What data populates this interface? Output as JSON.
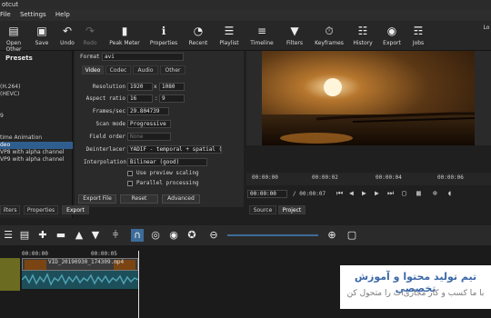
{
  "title": "Shotcut",
  "menu": [
    "otcut",
    "File",
    "Settings",
    "Help"
  ],
  "window_title_partial": "otcut",
  "toolbar": [
    {
      "label": "Open Other",
      "icon": "folder-icon",
      "enabled": true
    },
    {
      "label": "Save",
      "icon": "save-icon",
      "enabled": true
    },
    {
      "label": "Undo",
      "icon": "undo-icon",
      "enabled": true
    },
    {
      "label": "Redo",
      "icon": "redo-icon",
      "enabled": false
    },
    {
      "label": "Peak Meter",
      "icon": "peak-meter-icon",
      "enabled": true
    },
    {
      "label": "Properties",
      "icon": "info-icon",
      "enabled": true
    },
    {
      "label": "Recent",
      "icon": "recent-icon",
      "enabled": true
    },
    {
      "label": "Playlist",
      "icon": "playlist-icon",
      "enabled": true
    },
    {
      "label": "Timeline",
      "icon": "timeline-icon",
      "enabled": true
    },
    {
      "label": "Filters",
      "icon": "filter-icon",
      "enabled": true
    },
    {
      "label": "Keyframes",
      "icon": "keyframes-icon",
      "enabled": true
    },
    {
      "label": "History",
      "icon": "history-icon",
      "enabled": true
    },
    {
      "label": "Export",
      "icon": "export-icon",
      "enabled": true
    },
    {
      "label": "Jobs",
      "icon": "jobs-icon",
      "enabled": true
    },
    {
      "label": "Lo",
      "icon": "",
      "enabled": true
    }
  ],
  "presets": {
    "title": "Presets",
    "items": [
      {
        "label": "(H.264)",
        "selected": false
      },
      {
        "label": "(HEVC)",
        "selected": false
      },
      {
        "label": "9",
        "selected": false
      },
      {
        "label": "time Animation",
        "selected": false
      },
      {
        "label": "deo",
        "selected": true
      },
      {
        "label": "VP8 with alpha channel",
        "selected": false
      },
      {
        "label": "VP9 with alpha channel",
        "selected": false
      }
    ]
  },
  "export": {
    "format_label": "Format",
    "format_value": "avi",
    "tabs": [
      "Video",
      "Codec",
      "Audio",
      "Other"
    ],
    "fields": {
      "resolution_label": "Resolution",
      "res_w": "1920",
      "res_x": "x",
      "res_h": "1080",
      "aspect_label": "Aspect ratio",
      "asp_w": "16",
      "asp_colon": ":",
      "asp_h": "9",
      "fps_label": "Frames/sec",
      "fps": "29.804739",
      "scan_label": "Scan mode",
      "scan": "Progressive",
      "field_label": "Field order",
      "field": "None",
      "deint_label": "Deinterlacer",
      "deint": "YADIF - temporal + spatial (",
      "interp_label": "Interpolation",
      "interp": "Bilinear (good)",
      "preview_label": "Use preview scaling",
      "parallel_label": "Parallel processing"
    },
    "buttons": {
      "export": "Export File",
      "reset": "Reset",
      "advanced": "Advanced"
    }
  },
  "bottom_tabs": [
    "ilters",
    "Properties",
    "Export"
  ],
  "viewer": {
    "ruler": [
      "00:00:00",
      "00:00:02",
      "00:00:04",
      "00:00:06"
    ],
    "current": "00:00:00",
    "duration": "/  00:00:07",
    "tabs": [
      "Source",
      "Project"
    ]
  },
  "timeline": {
    "ruler": [
      "00:00:00",
      "00:00:05"
    ],
    "clip_name": "VID_20190930_174309.mp4"
  },
  "watermark": {
    "line1": "تیم تولید محتوا و آموزش تخصصی",
    "line2": "با ما کسب و کار مجازی‌ات را متحول کن"
  },
  "colors": {
    "accent": "#2f5e8e",
    "audio_clip": "#1d4f5a",
    "track_head": "#6b6b21"
  }
}
